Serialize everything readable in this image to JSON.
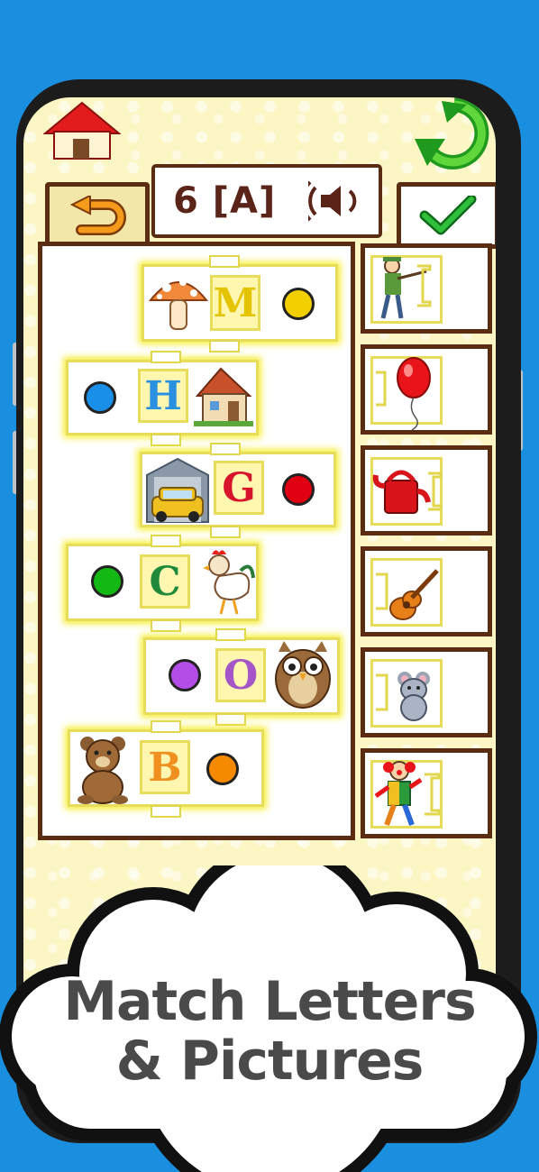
{
  "header": {
    "level_label": "6 [A]",
    "home_icon": "house-icon",
    "refresh_icon": "refresh-arrows-icon",
    "sound_icon": "speaker-icon",
    "back_icon": "undo-arrow-icon",
    "confirm_icon": "checkmark-icon"
  },
  "pieces": [
    {
      "letter": "M",
      "picture": "mushroom-icon",
      "dot_color": "#f2d000",
      "letter_color": "#e4c300"
    },
    {
      "letter": "H",
      "picture": "house-picture-icon",
      "dot_color": "#1a8fe8",
      "letter_color": "#2a90e0"
    },
    {
      "letter": "G",
      "picture": "car-garage-icon",
      "dot_color": "#e00012",
      "letter_color": "#d8142a"
    },
    {
      "letter": "C",
      "picture": "rooster-icon",
      "dot_color": "#14b814",
      "letter_color": "#1f8a3c"
    },
    {
      "letter": "O",
      "picture": "owl-icon",
      "dot_color": "#b44de8",
      "letter_color": "#a456c8"
    },
    {
      "letter": "B",
      "picture": "teddy-bear-icon",
      "dot_color": "#f58a00",
      "letter_color": "#f09020"
    }
  ],
  "side_pictures": [
    {
      "picture": "hunter-icon"
    },
    {
      "picture": "balloon-icon"
    },
    {
      "picture": "watering-can-icon"
    },
    {
      "picture": "guitar-icon"
    },
    {
      "picture": "mouse-icon"
    },
    {
      "picture": "clown-icon"
    }
  ],
  "banner": {
    "line1": "Match Letters",
    "line2": "& Pictures"
  }
}
